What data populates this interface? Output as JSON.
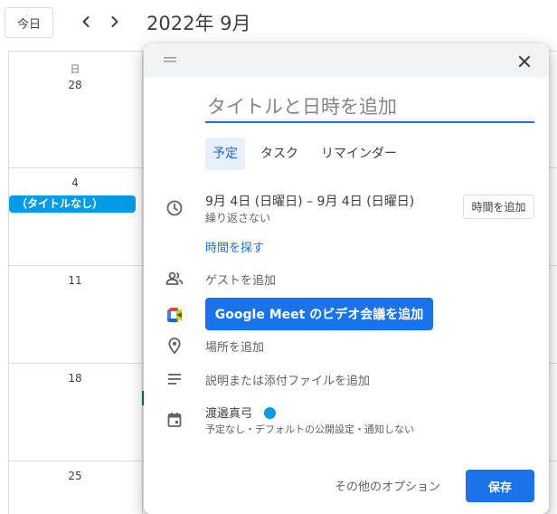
{
  "header": {
    "today_label": "今日",
    "month_title": "2022年 9月"
  },
  "calendar": {
    "weekday_label": "日",
    "day_numbers": [
      "28",
      "4",
      "11",
      "18",
      "25"
    ],
    "event_chip": "（タイトルなし）"
  },
  "dialog": {
    "title_placeholder": "タイトルと日時を追加",
    "tabs": [
      "予定",
      "タスク",
      "リマインダー"
    ],
    "date_range": "9月 4日 (日曜日)  –  9月 4日 (日曜日)",
    "repeat": "繰り返さない",
    "add_time_label": "時間を追加",
    "find_time_label": "時間を探す",
    "add_guests_label": "ゲストを追加",
    "meet_button_label": "Google Meet のビデオ会議を追加",
    "add_location_label": "場所を追加",
    "add_description_label": "説明または添付ファイルを追加",
    "calendar_owner": "渡邉真弓",
    "calendar_settings": "予定なし・デフォルトの公開設定・通知しない",
    "more_options_label": "その他のオプション",
    "save_label": "保存"
  },
  "colors": {
    "accent": "#1a73e8",
    "event_chip": "#039be5",
    "calendar_dot": "#039be5"
  },
  "icons": [
    "chevron-left-icon",
    "chevron-right-icon",
    "drag-handle-icon",
    "close-icon",
    "clock-icon",
    "people-icon",
    "google-meet-icon",
    "location-pin-icon",
    "description-icon",
    "calendar-icon"
  ]
}
